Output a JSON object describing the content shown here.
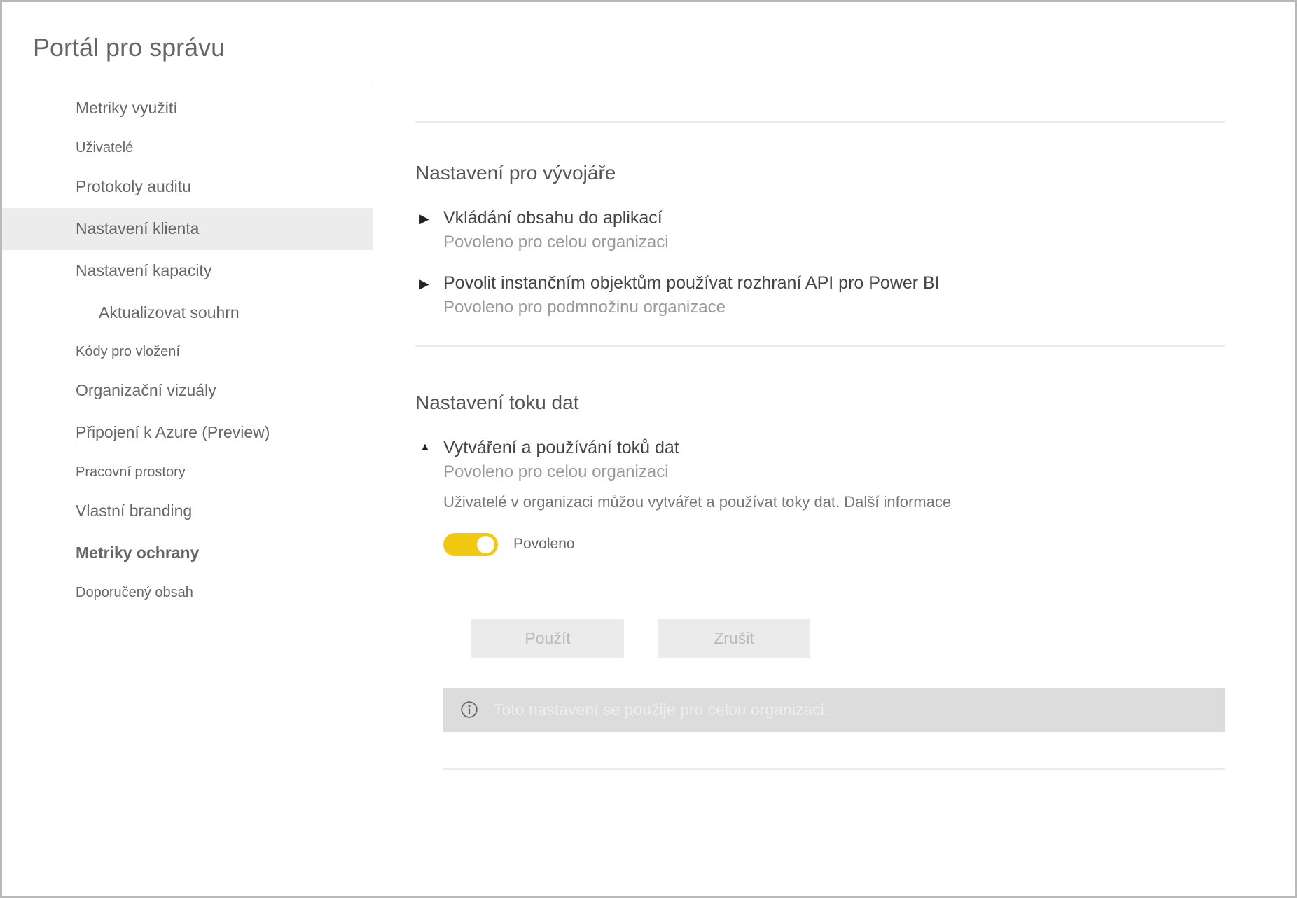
{
  "pageTitle": "Portál pro správu",
  "sidebar": {
    "items": [
      {
        "label": "Metriky využití",
        "size": "normal"
      },
      {
        "label": "Uživatelé",
        "size": "small"
      },
      {
        "label": "Protokoly auditu",
        "size": "normal"
      },
      {
        "label": "Nastavení klienta",
        "size": "normal",
        "active": true
      },
      {
        "label": "Nastavení kapacity",
        "size": "normal"
      },
      {
        "label": "Aktualizovat souhrn",
        "size": "normal",
        "indent": true
      },
      {
        "label": "Kódy pro vložení",
        "size": "small"
      },
      {
        "label": "Organizační vizuály",
        "size": "normal"
      },
      {
        "label": "Připojení k Azure (Preview)",
        "size": "normal"
      },
      {
        "label": "Pracovní prostory",
        "size": "small"
      },
      {
        "label": "Vlastní branding",
        "size": "normal"
      },
      {
        "label": "Metriky ochrany",
        "size": "normal",
        "bold": true
      },
      {
        "label": "Doporučený obsah",
        "size": "small"
      }
    ]
  },
  "sections": {
    "developer": {
      "title": "Nastavení pro vývojáře",
      "settings": [
        {
          "label": "Vkládání obsahu do aplikací",
          "status": "Povoleno pro celou organizaci",
          "expanded": false
        },
        {
          "label": "Povolit instančním objektům používat rozhraní API pro Power BI",
          "status": "Povoleno pro podmnožinu organizace",
          "expanded": false
        }
      ]
    },
    "dataflow": {
      "title": "Nastavení toku dat",
      "settings": [
        {
          "label": "Vytváření a používání toků dat",
          "status": "Povoleno pro celou organizaci",
          "expanded": true,
          "description": "Uživatelé v organizaci můžou vytvářet a používat toky dat. Další informace",
          "toggle": {
            "enabled": true,
            "label": "Povoleno"
          },
          "buttons": {
            "apply": "Použít",
            "cancel": "Zrušit"
          },
          "info": "Toto nastavení se použije pro celou organizaci."
        }
      ]
    }
  }
}
